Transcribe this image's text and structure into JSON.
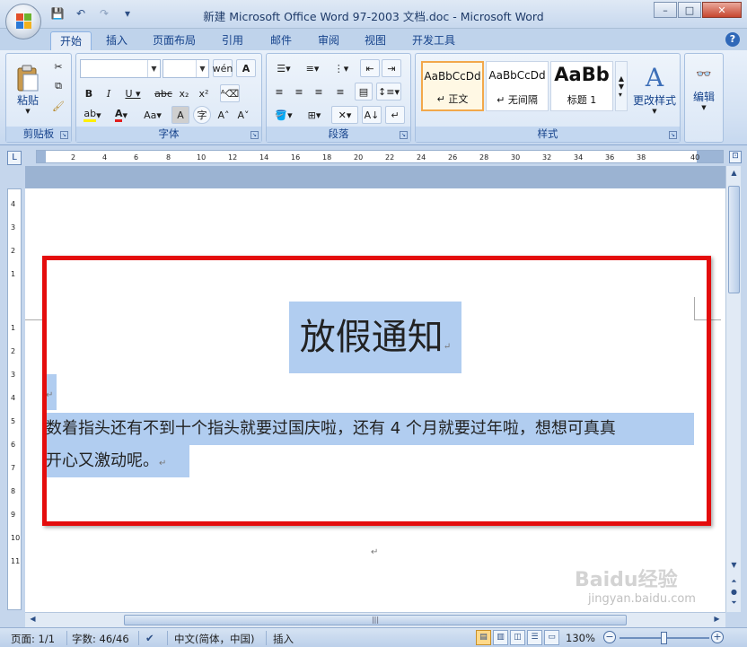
{
  "window": {
    "title": "新建 Microsoft Office Word 97-2003 文档.doc - Microsoft Word",
    "minimize": "–",
    "maximize": "□",
    "close": "✕"
  },
  "quick_access": {
    "save": "💾",
    "undo": "↶",
    "redo": "↷",
    "customize": "▾"
  },
  "tabs": [
    "开始",
    "插入",
    "页面布局",
    "引用",
    "邮件",
    "审阅",
    "视图",
    "开发工具"
  ],
  "active_tab": "开始",
  "help": "?",
  "ribbon": {
    "clipboard": {
      "label": "剪贴板",
      "paste": "粘贴"
    },
    "font": {
      "label": "字体",
      "font_name": "",
      "font_size": ""
    },
    "paragraph": {
      "label": "段落"
    },
    "styles": {
      "label": "样式",
      "items": [
        {
          "sample": "AaBbCcDd",
          "name": "↵ 正文"
        },
        {
          "sample": "AaBbCcDd",
          "name": "↵ 无间隔"
        },
        {
          "sample": "AaBb",
          "name": "标题 1"
        }
      ],
      "change_styles": "更改样式"
    },
    "editing": {
      "label": "编辑"
    }
  },
  "ruler_ticks": [
    "2",
    "4",
    "6",
    "8",
    "10",
    "12",
    "14",
    "16",
    "18",
    "20",
    "22",
    "24",
    "26",
    "28",
    "30",
    "32",
    "34",
    "36",
    "38",
    "40"
  ],
  "vruler_ticks": [
    "4",
    "3",
    "2",
    "1",
    "1",
    "2",
    "3",
    "4",
    "5",
    "6",
    "7",
    "8",
    "9",
    "10",
    "11"
  ],
  "document": {
    "title": "放假通知",
    "body_line1": "数着指头还有不到十个指头就要过国庆啦，还有 4 个月就要过年啦，想想可真真",
    "body_line2": "开心又激动呢。",
    "para_mark": "↵"
  },
  "status": {
    "page": "页面: 1/1",
    "words": "字数: 46/46",
    "language": "中文(简体，中国)",
    "mode": "插入",
    "zoom": "130%"
  },
  "watermark": {
    "brand": "Baidu经验",
    "url": "jingyan.baidu.com"
  },
  "colors": {
    "highlight_border": "#e40c0c",
    "selection": "#b1cdf0",
    "ribbon_bg": "#dbe7f6"
  }
}
